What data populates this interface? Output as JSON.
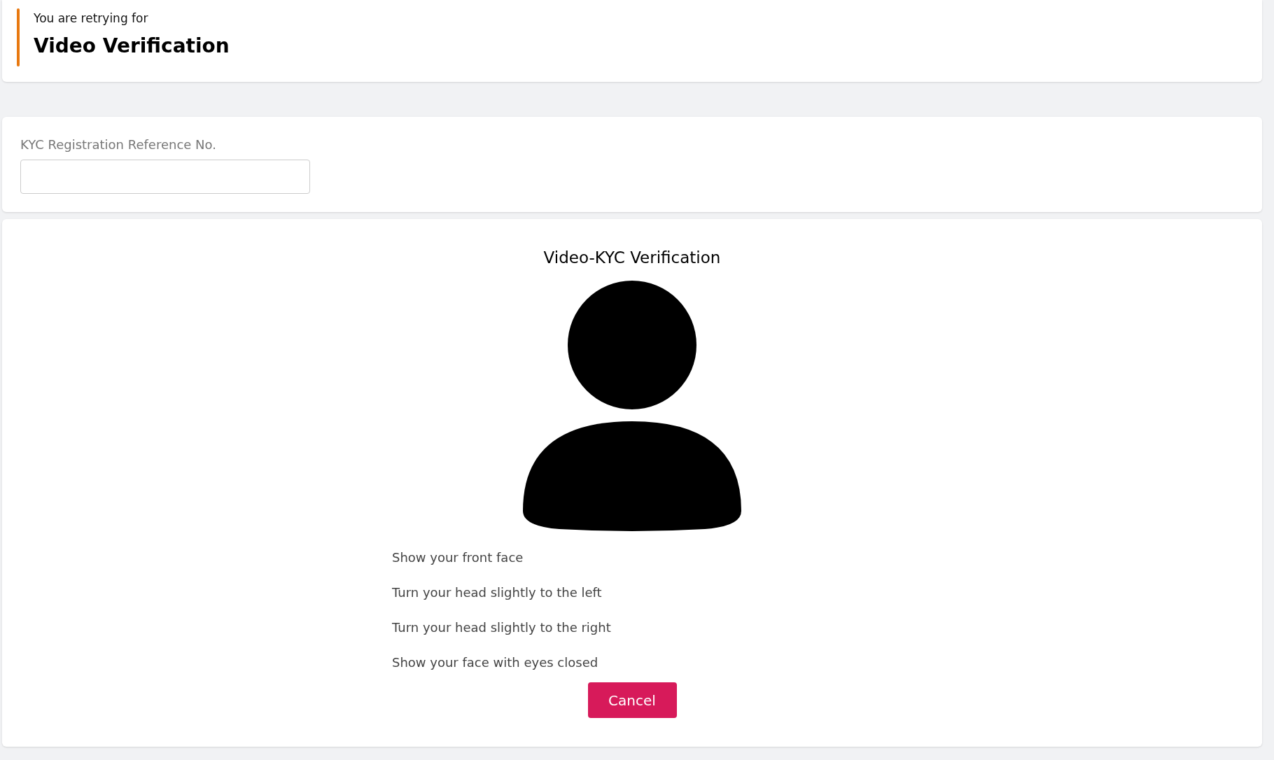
{
  "header": {
    "subtitle": "You are retrying for",
    "title": "Video Verification"
  },
  "reference_field": {
    "label": "KYC Registration Reference No."
  },
  "verification": {
    "title": "Video-KYC Verification",
    "instructions": [
      "Show your front face",
      "Turn your head slightly to the left",
      "Turn your head slightly to the right",
      "Show your face with eyes closed"
    ],
    "cancel_button": "Cancel"
  }
}
